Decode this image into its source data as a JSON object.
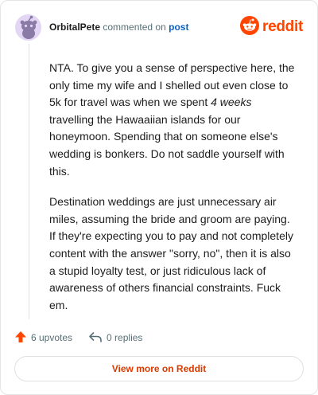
{
  "comment": {
    "username": "OrbitalPete",
    "action_text": "commented on",
    "post_link": "post",
    "paragraphs": [
      {
        "before": "NTA. To give you a sense of perspective here, the only time my wife and I shelled out even close to 5k for travel was when we spent ",
        "emphasis": "4 weeks",
        "after": " travelling the Hawaaiian islands for our honeymoon. Spending that on someone else's wedding is bonkers. Do not saddle yourself with this."
      },
      {
        "text": "Destination weddings are just unnecessary air miles, assuming the bride and groom are paying. If they're expecting you to pay and not completely content with the answer \"sorry, no\", then it is also a stupid loyalty test, or just ridiculous lack of awareness of others financial constraints. Fuck em."
      }
    ]
  },
  "brand": {
    "name": "reddit",
    "color": "#ff4500"
  },
  "actions": {
    "upvotes": "6 upvotes",
    "replies": "0 replies"
  },
  "footer": {
    "view_more": "View more on Reddit"
  },
  "icons": {
    "avatar": "snoo-avatar-icon",
    "brand": "reddit-logo-icon",
    "upvote": "upvote-arrow-icon",
    "reply": "reply-arrow-icon"
  },
  "colors": {
    "upvote": "#ff4500",
    "link": "#0a5fc4",
    "view_more": "#d93a00",
    "avatar_bg": "#e3d6f5"
  }
}
